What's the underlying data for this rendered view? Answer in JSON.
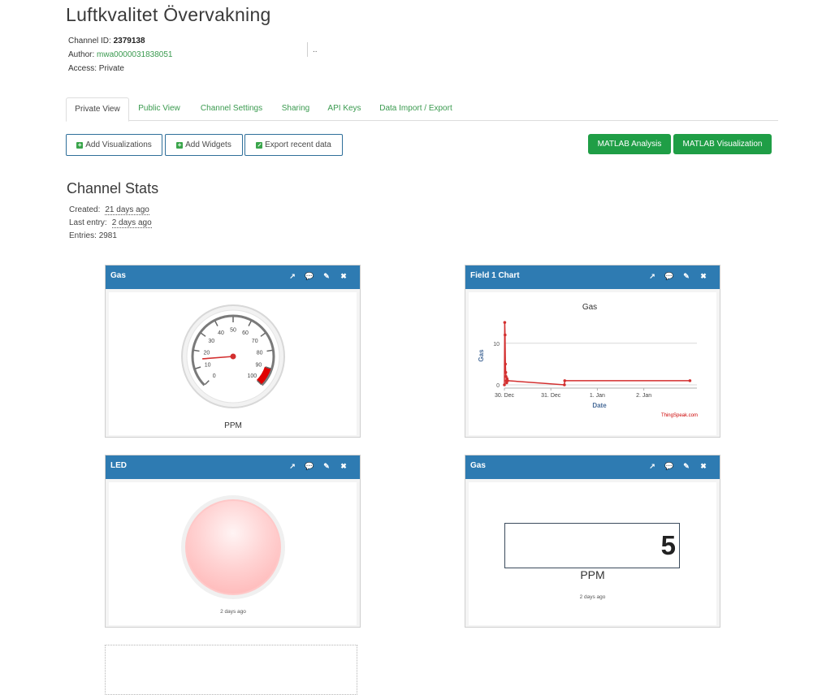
{
  "channel": {
    "title": "Luftkvalitet Övervakning",
    "id_label": "Channel ID:",
    "id_value": "2379138",
    "author_label": "Author:",
    "author_value": "mwa0000031838051",
    "access_label": "Access:",
    "access_value": "Private",
    "extra": ".."
  },
  "tabs": [
    "Private View",
    "Public View",
    "Channel Settings",
    "Sharing",
    "API Keys",
    "Data Import / Export"
  ],
  "actions": {
    "add_visualizations": "Add Visualizations",
    "add_widgets": "Add Widgets",
    "export_recent": "Export recent data",
    "matlab_analysis": "MATLAB Analysis",
    "matlab_visualization": "MATLAB Visualization"
  },
  "stats": {
    "title": "Channel Stats",
    "created_label": "Created:",
    "created_value": "21 days ago",
    "last_entry_label": "Last entry:",
    "last_entry_value": "2 days ago",
    "entries_label": "Entries:",
    "entries_value": "2981"
  },
  "widgets": {
    "gauge": {
      "title": "Gas",
      "unit": "PPM",
      "value": 15,
      "min": 0,
      "max": 100,
      "danger_from": 90,
      "ticks": [
        "0",
        "10",
        "20",
        "30",
        "40",
        "50",
        "60",
        "70",
        "80",
        "90",
        "100"
      ],
      "colors": {
        "needle": "#d32f2f",
        "danger": "#e00000"
      }
    },
    "chart": {
      "title": "Field 1 Chart",
      "chart_title": "Gas",
      "xlabel": "Date",
      "ylabel": "Gas",
      "credit": "ThingSpeak.com",
      "yticks": [
        "0",
        "10"
      ],
      "xticks": [
        "30. Dec",
        "31. Dec",
        "1. Jan",
        "2. Jan"
      ]
    },
    "led": {
      "title": "LED",
      "timestamp": "2 days ago",
      "color": "#ffc6c6"
    },
    "numeric": {
      "title": "Gas",
      "value": "5",
      "unit": "PPM",
      "timestamp": "2 days ago"
    }
  },
  "icons": [
    "external-link-icon",
    "comment-icon",
    "pencil-icon",
    "close-icon"
  ],
  "chart_data": {
    "type": "line",
    "title": "Gas",
    "xlabel": "Date",
    "ylabel": "Gas",
    "x": [
      "2023-12-30 00:00",
      "2023-12-30 00:10",
      "2023-12-30 00:20",
      "2023-12-30 00:30",
      "2023-12-30 00:40",
      "2023-12-30 00:50",
      "2023-12-30 01:00",
      "2023-12-30 01:10",
      "2023-12-30 01:20",
      "2023-12-30 01:30",
      "2023-12-30 01:40",
      "2023-12-31 07:00",
      "2023-12-31 07:10",
      "2024-01-02 23:50"
    ],
    "y": [
      0,
      15,
      12,
      5,
      3,
      2,
      1,
      0.5,
      1.5,
      1,
      1,
      0,
      1,
      1
    ],
    "ylim": [
      0,
      16
    ],
    "xticks": [
      "30. Dec",
      "31. Dec",
      "1. Jan",
      "2. Jan"
    ],
    "color": "#d32f2f"
  }
}
